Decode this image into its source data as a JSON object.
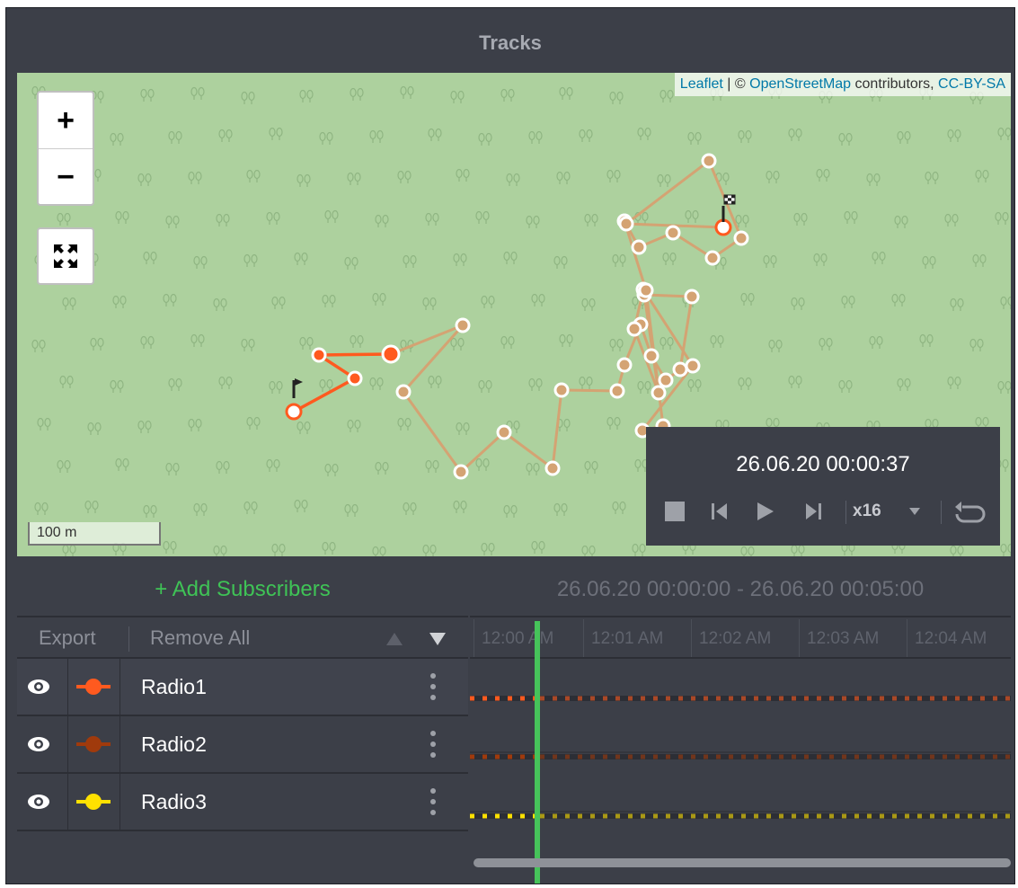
{
  "window": {
    "title": "Tracks"
  },
  "map": {
    "attribution": {
      "leaflet": "Leaflet",
      "separator": " | © ",
      "osm": "OpenStreetMap",
      "contributors": " contributors, ",
      "license": "CC-BY-SA"
    },
    "zoom_in_label": "+",
    "zoom_out_label": "−",
    "scale_label": "100 m",
    "background_color": "#add19e",
    "track_color_active": "#ff5a1f",
    "track_color_inactive": "#d4a373"
  },
  "player": {
    "time": "26.06.20 00:00:37",
    "speed": "x16",
    "stop_icon": "stop-icon",
    "prev_icon": "skip-back-icon",
    "play_icon": "play-icon",
    "next_icon": "skip-forward-icon",
    "loop_icon": "loop-icon"
  },
  "panel": {
    "add_subscribers": "+ Add Subscribers",
    "export_label": "Export",
    "remove_all_label": "Remove All",
    "subscribers": [
      {
        "name": "Radio1",
        "color": "#ff5a1f"
      },
      {
        "name": "Radio2",
        "color": "#a03a0c"
      },
      {
        "name": "Radio3",
        "color": "#ffe100"
      }
    ]
  },
  "timeline": {
    "range": "26.06.20 00:00:00 - 26.06.20 00:05:00",
    "ticks": [
      "12:00 AM",
      "12:01 AM",
      "12:02 AM",
      "12:03 AM",
      "12:04 AM"
    ],
    "cursor_color": "#46c35a"
  }
}
